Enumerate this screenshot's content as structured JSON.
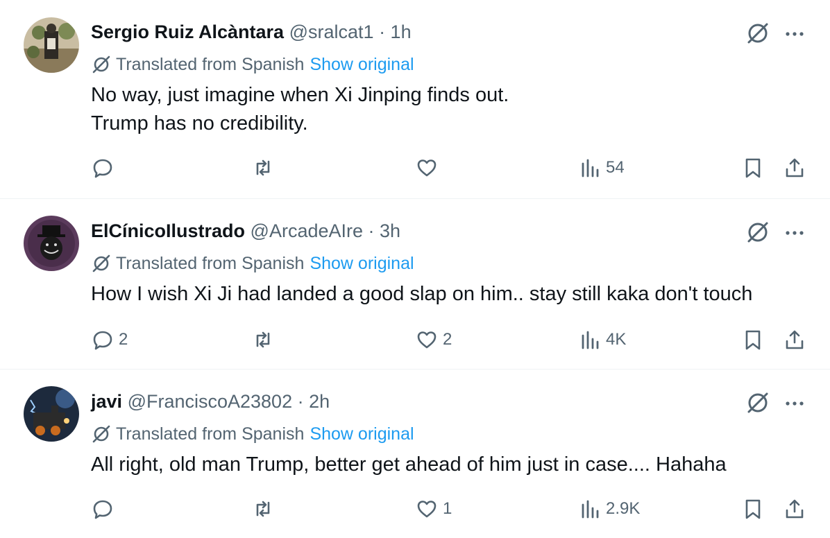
{
  "tweets": [
    {
      "name": "Sergio Ruiz Alcàntara",
      "handle": "@sralcat1",
      "time": "· 1h",
      "translated_label": "Translated from Spanish",
      "show_original": "Show original",
      "text": "No way, just imagine when Xi Jinping finds out.\nTrump has no credibility.",
      "replies": "",
      "retweets": "",
      "likes": "",
      "views": "54"
    },
    {
      "name": "ElCínicoIlustrado",
      "handle": "@ArcadeAIre",
      "time": "· 3h",
      "translated_label": "Translated from Spanish",
      "show_original": "Show original",
      "text": "How I wish Xi Ji had landed a good slap on him.. stay still kaka don't touch",
      "replies": "2",
      "retweets": "",
      "likes": "2",
      "views": "4K"
    },
    {
      "name": "javi",
      "handle": "@FranciscoA23802",
      "time": "· 2h",
      "translated_label": "Translated from Spanish",
      "show_original": "Show original",
      "text": "All right, old man Trump, better get ahead of him just in case.... Hahaha",
      "replies": "",
      "retweets": "",
      "likes": "1",
      "views": "2.9K"
    }
  ],
  "colors": {
    "text": "#0f1419",
    "secondary": "#536471",
    "link": "#1d9bf0",
    "border": "#eff3f4"
  },
  "icons": [
    "grok-icon",
    "more-icon",
    "translate-icon",
    "reply-icon",
    "retweet-icon",
    "like-icon",
    "views-icon",
    "bookmark-icon",
    "share-icon"
  ]
}
